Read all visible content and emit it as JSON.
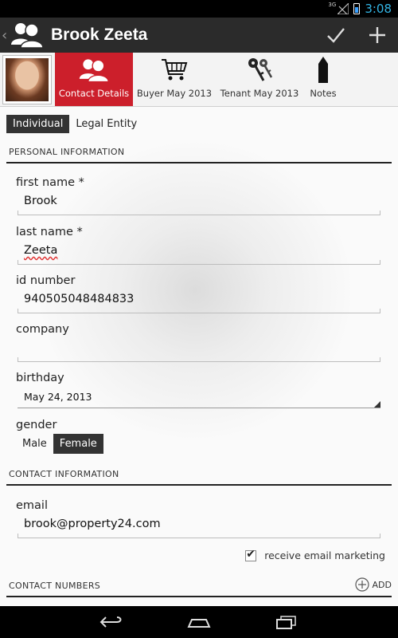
{
  "status": {
    "network": "3G",
    "time": "3:08"
  },
  "actionbar": {
    "title": "Brook Zeeta",
    "back_glyph": "‹"
  },
  "tabs": [
    {
      "label": "Contact Details",
      "icon": "contacts-icon",
      "active": true
    },
    {
      "label": "Buyer May 2013",
      "icon": "cart-icon"
    },
    {
      "label": "Tenant May 2013",
      "icon": "keys-icon"
    },
    {
      "label": "Notes",
      "icon": "pencil-icon"
    }
  ],
  "entity_type": {
    "options": [
      "Individual",
      "Legal Entity"
    ],
    "selected": "Individual"
  },
  "personal": {
    "section_title": "PERSONAL INFORMATION",
    "first_name_label": "first name *",
    "first_name": "Brook",
    "last_name_label": "last name *",
    "last_name": "Zeeta",
    "id_number_label": "id number",
    "id_number": "940505048484833",
    "company_label": "company",
    "company": "",
    "birthday_label": "birthday",
    "birthday": "May 24, 2013",
    "gender_label": "gender",
    "gender_options": [
      "Male",
      "Female"
    ],
    "gender_selected": "Female"
  },
  "contact": {
    "section_title": "CONTACT INFORMATION",
    "email_label": "email",
    "email": "brook@property24.com",
    "marketing_label": "receive email marketing",
    "marketing_checked": true
  },
  "numbers": {
    "section_title": "CONTACT NUMBERS",
    "add_label": "ADD"
  },
  "colors": {
    "accent": "#cc1f2b",
    "actionbar": "#2b2b2b",
    "clock": "#33b5e5"
  }
}
